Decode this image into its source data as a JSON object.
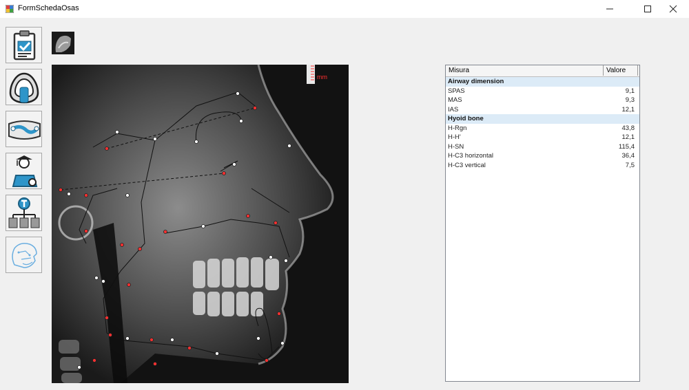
{
  "window": {
    "title": "FormSchedaOsas",
    "controls": [
      "minimize-icon",
      "maximize-icon",
      "close-icon"
    ]
  },
  "toolbar": {
    "buttons": [
      {
        "name": "clipboard-check-icon"
      },
      {
        "name": "airway-mask-icon"
      },
      {
        "name": "airway-tube-icon"
      },
      {
        "name": "doctor-patient-icon"
      },
      {
        "name": "hierarchy-t-icon"
      },
      {
        "name": "skull-tracing-icon"
      }
    ]
  },
  "xray": {
    "scale_label": "mm",
    "colors": {
      "point_red": "#ff3030",
      "point_white": "#ffffff",
      "line": "#111111"
    }
  },
  "grid": {
    "columns": [
      "Misura",
      "Valore"
    ],
    "sections": [
      {
        "title": "Airway dimension",
        "rows": [
          {
            "label": "SPAS",
            "value": "9,1"
          },
          {
            "label": "MAS",
            "value": "9,3"
          },
          {
            "label": "IAS",
            "value": "12,1"
          }
        ]
      },
      {
        "title": "Hyoid bone",
        "rows": [
          {
            "label": "H-Rgn",
            "value": "43,8"
          },
          {
            "label": "H-H'",
            "value": "12,1"
          },
          {
            "label": "H-SN",
            "value": "115,4"
          },
          {
            "label": "H-C3 horizontal",
            "value": "36,4"
          },
          {
            "label": "H-C3 vertical",
            "value": "7,5"
          }
        ]
      }
    ],
    "section_color": "#dcebf7"
  }
}
